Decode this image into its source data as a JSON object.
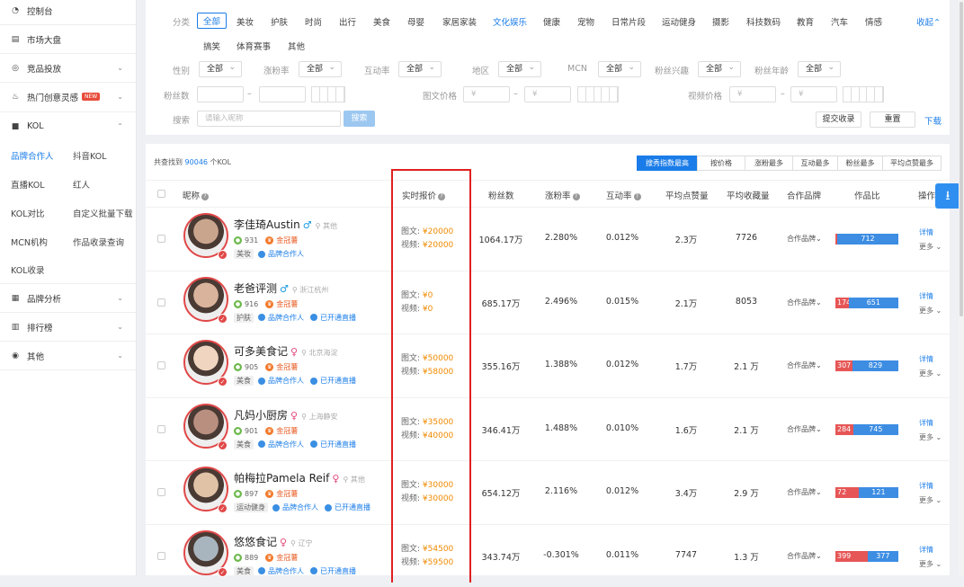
{
  "sidebar": {
    "items": [
      {
        "label": "控制台",
        "icon": "dashboard-icon"
      },
      {
        "label": "市场大盘",
        "icon": "market-icon"
      },
      {
        "label": "竞品投放",
        "icon": "target-icon"
      },
      {
        "label": "热门创意灵感",
        "icon": "fire-icon",
        "badge": "NEW"
      },
      {
        "label": "KOL",
        "icon": "kol-icon"
      },
      {
        "label": "品牌分析",
        "icon": "brand-analysis-icon"
      },
      {
        "label": "排行榜",
        "icon": "ranking-icon"
      },
      {
        "label": "其他",
        "icon": "other-icon"
      }
    ],
    "kol_sub": [
      "品牌合作人",
      "抖音KOL",
      "直播KOL",
      "红人",
      "KOL对比",
      "自定义批量下载",
      "MCN机构",
      "作品收录查询",
      "KOL收录"
    ]
  },
  "filter": {
    "cat_label": "分类",
    "categories": [
      "全部",
      "美妆",
      "护肤",
      "时尚",
      "出行",
      "美食",
      "母婴",
      "家居家装",
      "文化娱乐",
      "健康",
      "宠物",
      "日常片段",
      "运动健身",
      "摄影",
      "科技数码",
      "教育",
      "汽车",
      "情感"
    ],
    "categories2": [
      "搞笑",
      "体育赛事",
      "其他"
    ],
    "collapse": "收起",
    "selects": [
      {
        "label": "性别",
        "value": "全部"
      },
      {
        "label": "涨粉率",
        "value": "全部"
      },
      {
        "label": "互动率",
        "value": "全部"
      },
      {
        "label": "地区",
        "value": "全部"
      },
      {
        "label": "MCN",
        "value": "全部"
      },
      {
        "label": "粉丝兴趣",
        "value": "全部"
      },
      {
        "label": "粉丝年龄",
        "value": "全部"
      }
    ],
    "fans_label": "粉丝数",
    "img_price_label": "图文价格",
    "video_price_label": "视频价格",
    "yen_placeholder": "¥",
    "dash": "–",
    "search_label": "搜索",
    "search_placeholder": "请输入昵称",
    "search_btn": "搜索",
    "submit_btn": "提交收录",
    "reset_btn": "重置",
    "download": "下载"
  },
  "results": {
    "prefix": "共查找到",
    "count": "90046",
    "suffix": "个KOL",
    "sort_buttons": [
      "搜秀指数最高",
      "按价格",
      "涨粉最多",
      "互动最多",
      "粉丝最多",
      "平均点赞最多"
    ]
  },
  "headers": [
    "昵称",
    "实时报价",
    "粉丝数",
    "涨粉率",
    "互动率",
    "平均点赞量",
    "平均收藏量",
    "合作品牌",
    "作品比",
    "操作"
  ],
  "rows": [
    {
      "name": "李佳琦Austin",
      "gender": "♂",
      "location": "其他",
      "score": "931",
      "level": "金冠薯",
      "tags": [
        "美妆"
      ],
      "coop": "品牌合作人",
      "live": "",
      "img_price": "¥20000",
      "video_price": "¥20000",
      "fans": "1064.17万",
      "growth": "2.280%",
      "interact": "0.012%",
      "likes": "2.3万",
      "collects": "7726",
      "brand": "合作品牌",
      "ratio_a": "",
      "ratio_b": "712",
      "ratio_a_pct": 2
    },
    {
      "name": "老爸评测",
      "gender": "♂",
      "location": "浙江杭州",
      "score": "916",
      "level": "金冠薯",
      "tags": [
        "护肤"
      ],
      "coop": "品牌合作人",
      "live": "已开通直播",
      "img_price": "¥0",
      "video_price": "¥0",
      "fans": "685.17万",
      "growth": "2.496%",
      "interact": "0.015%",
      "likes": "2.1万",
      "collects": "8053",
      "brand": "合作品牌",
      "ratio_a": "174",
      "ratio_b": "651",
      "ratio_a_pct": 21
    },
    {
      "name": "可多美食记",
      "gender": "♀",
      "location": "北京海淀",
      "score": "905",
      "level": "金冠薯",
      "tags": [
        "美食"
      ],
      "coop": "品牌合作人",
      "live": "已开通直播",
      "img_price": "¥50000",
      "video_price": "¥58000",
      "fans": "355.16万",
      "growth": "1.388%",
      "interact": "0.012%",
      "likes": "1.7万",
      "collects": "2.1 万",
      "brand": "合作品牌",
      "ratio_a": "307",
      "ratio_b": "829",
      "ratio_a_pct": 27
    },
    {
      "name": "凡妈小厨房",
      "gender": "♀",
      "location": "上海静安",
      "score": "901",
      "level": "金冠薯",
      "tags": [
        "美食"
      ],
      "coop": "品牌合作人",
      "live": "已开通直播",
      "img_price": "¥35000",
      "video_price": "¥40000",
      "fans": "346.41万",
      "growth": "1.488%",
      "interact": "0.010%",
      "likes": "1.6万",
      "collects": "2.1 万",
      "brand": "合作品牌",
      "ratio_a": "284",
      "ratio_b": "745",
      "ratio_a_pct": 28
    },
    {
      "name": "帕梅拉Pamela Reif",
      "gender": "♀",
      "location": "其他",
      "score": "897",
      "level": "金冠薯",
      "tags": [
        "运动健身"
      ],
      "coop": "品牌合作人",
      "live": "已开通直播",
      "img_price": "¥30000",
      "video_price": "¥30000",
      "fans": "654.12万",
      "growth": "2.116%",
      "interact": "0.012%",
      "likes": "3.4万",
      "collects": "2.9 万",
      "brand": "合作品牌",
      "ratio_a": "72",
      "ratio_b": "121",
      "ratio_a_pct": 37
    },
    {
      "name": "悠悠食记",
      "gender": "♀",
      "location": "辽宁",
      "score": "889",
      "level": "金冠薯",
      "tags": [
        "美食"
      ],
      "coop": "品牌合作人",
      "live": "已开通直播",
      "img_price": "¥54500",
      "video_price": "¥59500",
      "fans": "343.74万",
      "growth": "-0.301%",
      "interact": "0.011%",
      "likes": "7747",
      "collects": "1.3 万",
      "brand": "合作品牌",
      "ratio_a": "399",
      "ratio_b": "377",
      "ratio_a_pct": 51
    }
  ],
  "labels": {
    "img": "图文:",
    "video": "视频:",
    "detail": "详情",
    "more": "更多"
  },
  "colors": {
    "accent": "#1a7ce8",
    "highlight_box": "#e02020",
    "price": "#f08a00",
    "ratio_red": "#e65656",
    "ratio_blue": "#3d8de3"
  }
}
